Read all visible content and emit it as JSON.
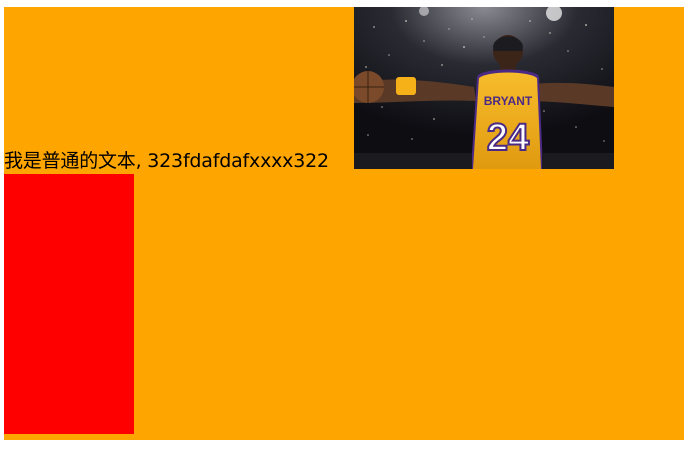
{
  "inline_text": "我是普通的文本, 323fdafdafxxxx322",
  "photo": {
    "jersey_name": "BRYANT",
    "jersey_number": "24"
  },
  "colors": {
    "container_background": "#ffa500",
    "block": "#ff0000",
    "jersey": "#f5b117",
    "jersey_trim": "#4b2a85"
  },
  "icons": [
    "basketball-player-photo"
  ]
}
